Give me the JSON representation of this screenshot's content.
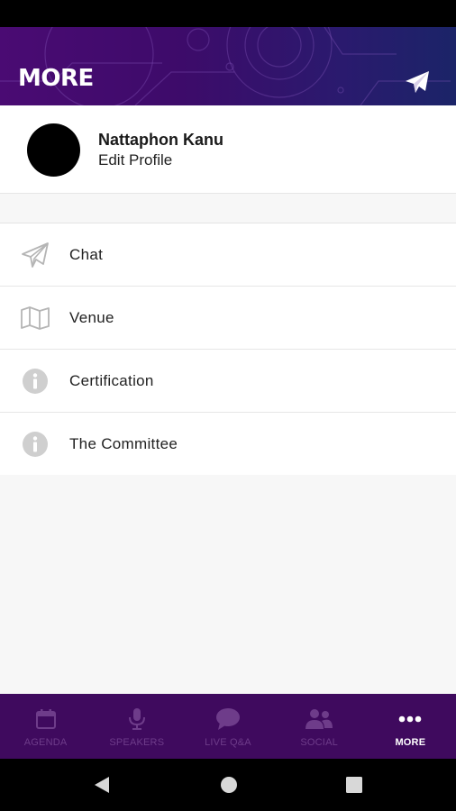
{
  "header": {
    "title": "MORE",
    "send_icon": "paper-plane-icon",
    "gradient_start": "#4a0b73",
    "gradient_end": "#1b2468"
  },
  "profile": {
    "name": "Nattaphon Kanu",
    "subtitle": "Edit Profile"
  },
  "menu": {
    "items": [
      {
        "label": "Chat",
        "icon": "paper-plane-outline-icon"
      },
      {
        "label": "Venue",
        "icon": "map-icon"
      },
      {
        "label": "Certification",
        "icon": "info-circle-icon"
      },
      {
        "label": "The Committee",
        "icon": "info-circle-icon"
      }
    ]
  },
  "bottom_nav": {
    "background": "#3f0a5e",
    "items": [
      {
        "label": "AGENDA",
        "icon": "calendar-icon",
        "active": false
      },
      {
        "label": "SPEAKERS",
        "icon": "microphone-icon",
        "active": false
      },
      {
        "label": "LIVE Q&A",
        "icon": "chat-bubble-icon",
        "active": false
      },
      {
        "label": "SOCIAL",
        "icon": "users-icon",
        "active": false
      },
      {
        "label": "MORE",
        "icon": "more-dots-icon",
        "active": true
      }
    ]
  },
  "system_nav": {
    "icons": [
      "back-triangle-icon",
      "home-circle-icon",
      "recents-square-icon"
    ]
  }
}
